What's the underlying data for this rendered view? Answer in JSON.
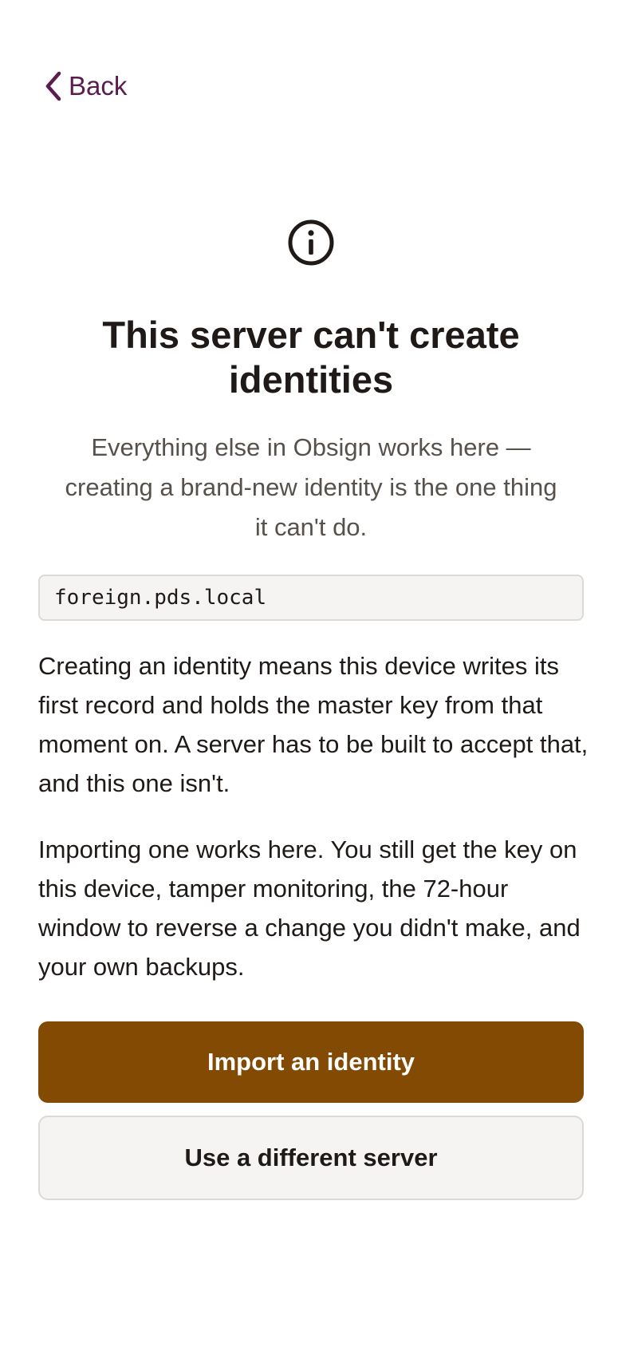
{
  "nav": {
    "back_label": "Back",
    "back_icon": "chevron-left-icon"
  },
  "hero": {
    "icon": "info-icon",
    "title": "This server can't create identities",
    "subtitle": "Everything else in Obsign works here — creating a brand-new identity is the one thing it can't do."
  },
  "server": {
    "host": "foreign.pds.local"
  },
  "body": {
    "paragraph_1": "Creating an identity means this device writes its first record and holds the master key from that moment on. A server has to be built to accept that, and this one isn't.",
    "paragraph_2": "Importing one works here. You still get the key on this device, tamper monitoring, the 72-hour window to reverse a change you didn't make, and your own backups."
  },
  "actions": {
    "primary_label": "Import an identity",
    "secondary_label": "Use a different server"
  },
  "colors": {
    "accent": "#824a02",
    "link": "#5a1d4f",
    "text": "#1f1a17",
    "muted": "#57514c",
    "surface": "#f5f4f2",
    "border": "#dcdad7"
  }
}
